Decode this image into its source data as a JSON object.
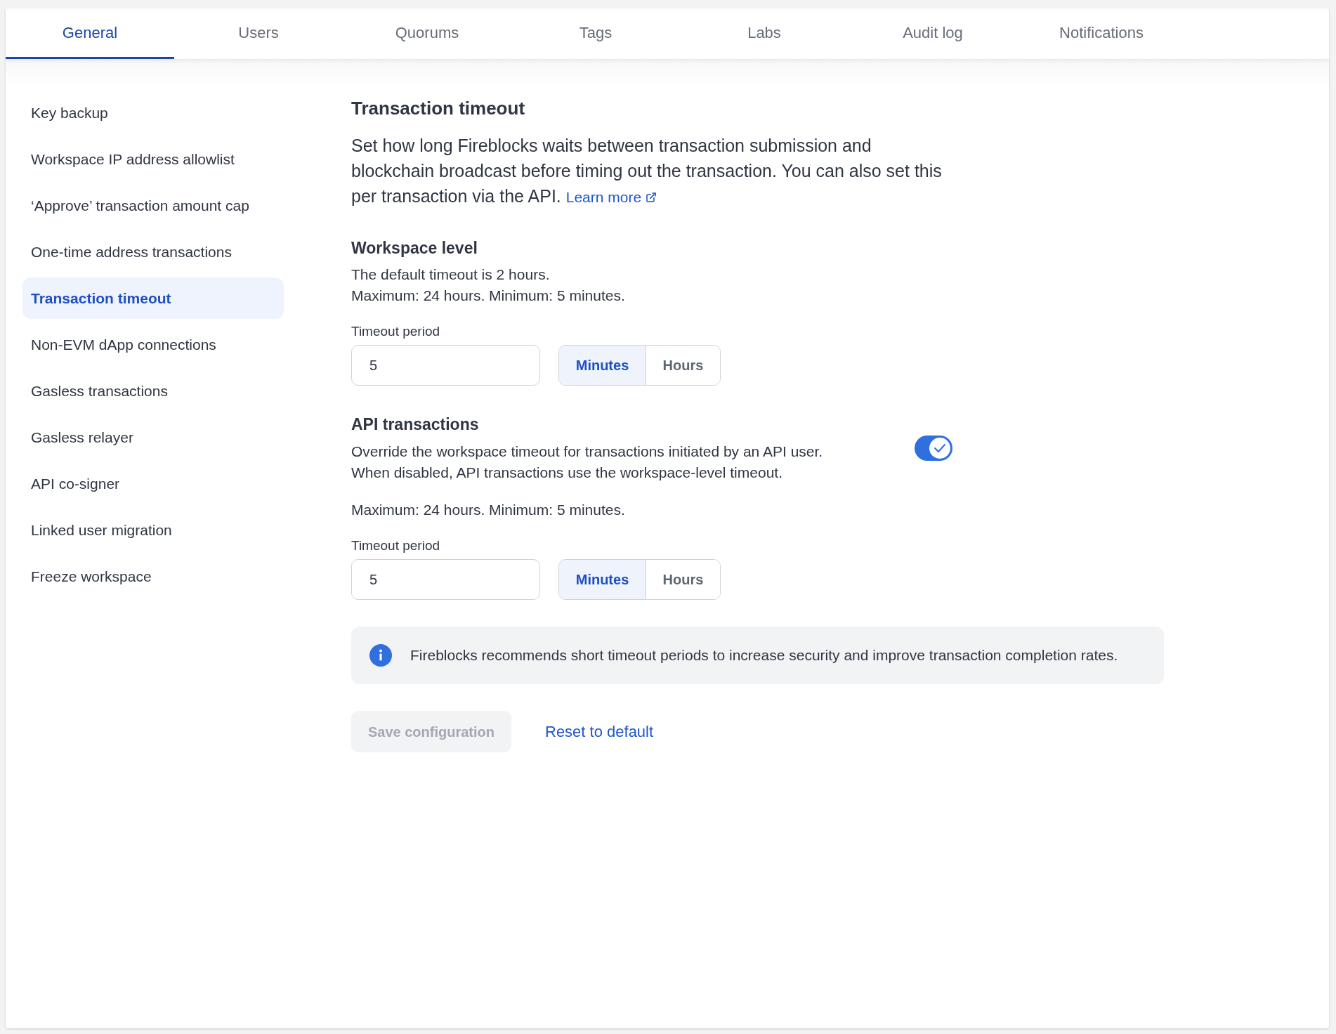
{
  "tabs": [
    {
      "label": "General",
      "selected": true
    },
    {
      "label": "Users",
      "selected": false
    },
    {
      "label": "Quorums",
      "selected": false
    },
    {
      "label": "Tags",
      "selected": false
    },
    {
      "label": "Labs",
      "selected": false
    },
    {
      "label": "Audit log",
      "selected": false
    },
    {
      "label": "Notifications",
      "selected": false
    }
  ],
  "sidebar": {
    "items": [
      {
        "label": "Key backup",
        "selected": false
      },
      {
        "label": "Workspace IP address allowlist",
        "selected": false
      },
      {
        "label": "‘Approve’ transaction amount cap",
        "selected": false
      },
      {
        "label": "One-time address transactions",
        "selected": false
      },
      {
        "label": "Transaction timeout",
        "selected": true
      },
      {
        "label": "Non-EVM dApp connections",
        "selected": false
      },
      {
        "label": "Gasless transactions",
        "selected": false
      },
      {
        "label": "Gasless relayer",
        "selected": false
      },
      {
        "label": "API co-signer",
        "selected": false
      },
      {
        "label": "Linked user migration",
        "selected": false
      },
      {
        "label": "Freeze workspace",
        "selected": false
      }
    ]
  },
  "section": {
    "title": "Transaction timeout",
    "description": "Set how long Fireblocks waits between transaction submission and blockchain broadcast before timing out the transaction. You can also set this per transaction via the API.",
    "learn_more_link": "Learn more"
  },
  "workspace_level": {
    "heading": "Workspace level",
    "lines": [
      "The default timeout is 2 hours.",
      "Maximum: 24 hours. Minimum: 5 minutes."
    ],
    "timeout": {
      "label": "Timeout period",
      "value": "5",
      "units": [
        {
          "label": "Minutes",
          "selected": true
        },
        {
          "label": "Hours",
          "selected": false
        }
      ]
    }
  },
  "api_transactions": {
    "heading": "API transactions",
    "lines": [
      "Override the workspace timeout for transactions initiated by an API user.",
      "When disabled, API transactions use the workspace-level timeout."
    ],
    "toggle": {
      "on": true
    },
    "limits": "Maximum: 24 hours. Minimum: 5 minutes.",
    "timeout": {
      "label": "Timeout period",
      "value": "5",
      "units": [
        {
          "label": "Minutes",
          "selected": true
        },
        {
          "label": "Hours",
          "selected": false
        }
      ]
    }
  },
  "info_banner": {
    "text": "Fireblocks recommends short timeout periods to increase security and improve transaction completion rates."
  },
  "actions": {
    "save_button": {
      "label": "Save configuration",
      "disabled": true
    },
    "reset_link": "Reset to default"
  }
}
